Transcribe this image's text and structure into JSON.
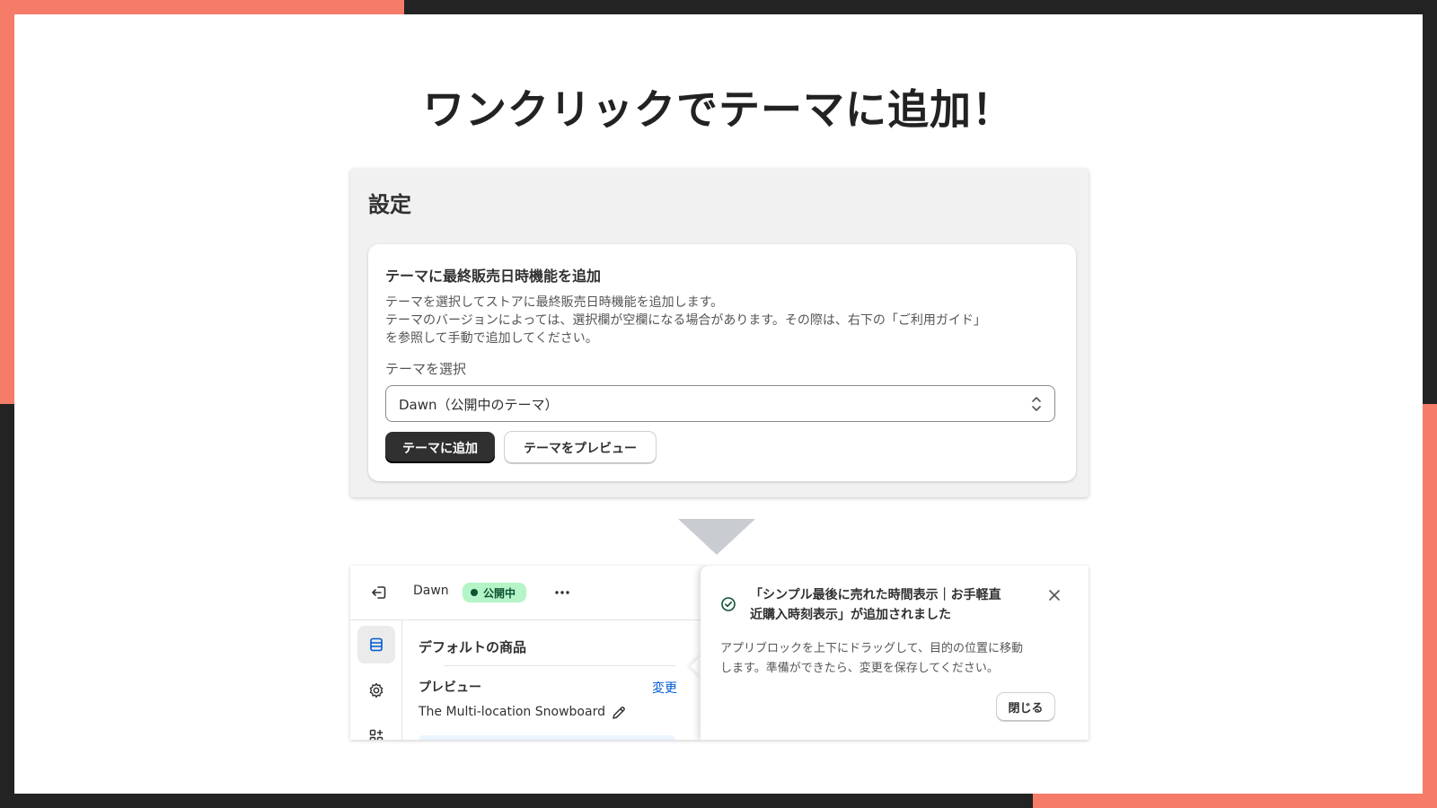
{
  "colors": {
    "accent": "#f47c68",
    "dark": "#232323",
    "primary_button": "#303030",
    "badge_bg": "#b4f4c6",
    "link": "#005bd3"
  },
  "headline": "ワンクリックでテーマに追加！",
  "settings": {
    "title": "設定",
    "card": {
      "title": "テーマに最終販売日時機能を追加",
      "description_lines": [
        "テーマを選択してストアに最終販売日時機能を追加します。",
        "テーマのバージョンによっては、選択欄が空欄になる場合があります。その際は、右下の「ご利用ガイド」",
        "を参照して手動で追加してください。"
      ],
      "select_label": "テーマを選択",
      "select_value": "Dawn（公開中のテーマ）",
      "add_button": "テーマに追加",
      "preview_button": "テーマをプレビュー"
    }
  },
  "editor": {
    "theme_name": "Dawn",
    "status_badge": "公開中",
    "section_heading": "デフォルトの商品",
    "preview_label": "プレビュー",
    "change_link": "変更",
    "product_name": "The Multi-location Snowboard",
    "icons": [
      "exit-icon",
      "more-icon",
      "sections-icon",
      "gear-icon",
      "apps-icon",
      "pencil-icon"
    ]
  },
  "popover": {
    "title_lines": [
      "「シンプル最後に売れた時間表示｜お手軽直",
      "近購入時刻表示」が追加されました"
    ],
    "body_lines": [
      "アプリブロックを上下にドラッグして、目的の位置に移動",
      "します。準備ができたら、変更を保存してください。"
    ],
    "close_button": "閉じる"
  }
}
